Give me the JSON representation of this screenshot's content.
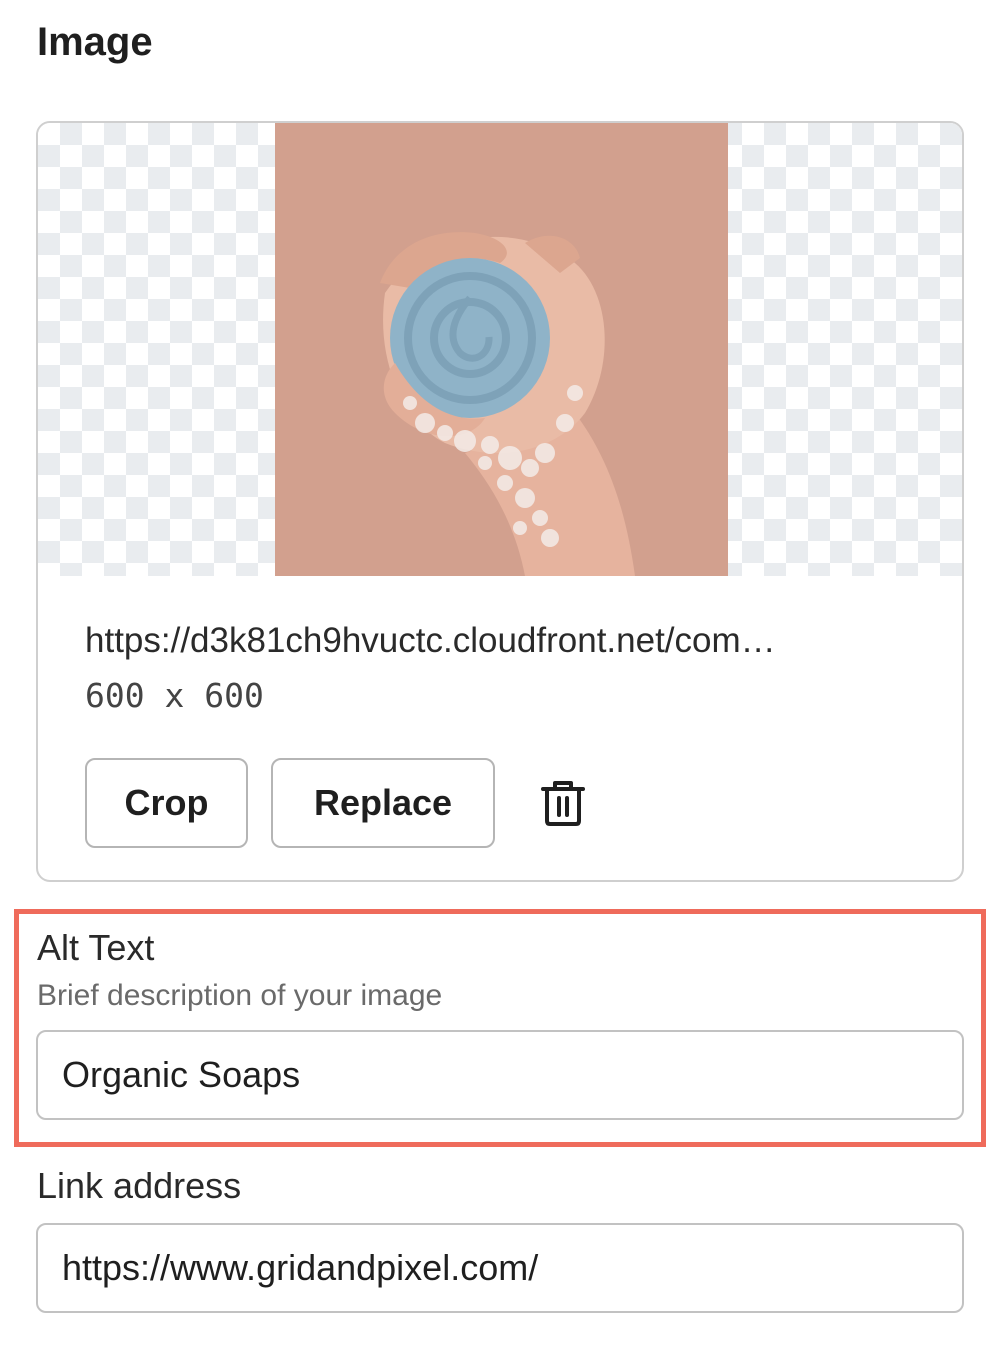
{
  "section": {
    "title": "Image"
  },
  "image": {
    "url": "https://d3k81ch9hvuctc.cloudfront.net/com…",
    "dimensions": "600 x 600",
    "crop_label": "Crop",
    "replace_label": "Replace",
    "delete_icon": "trash-icon"
  },
  "alt_text": {
    "label": "Alt Text",
    "help": "Brief description of your image",
    "value": "Organic Soaps"
  },
  "link": {
    "label": "Link address",
    "value": "https://www.gridandpixel.com/"
  },
  "colors": {
    "highlight": "#ef6b5b",
    "photo_background": "#d2a08e",
    "soap": "#8fb3c8"
  }
}
